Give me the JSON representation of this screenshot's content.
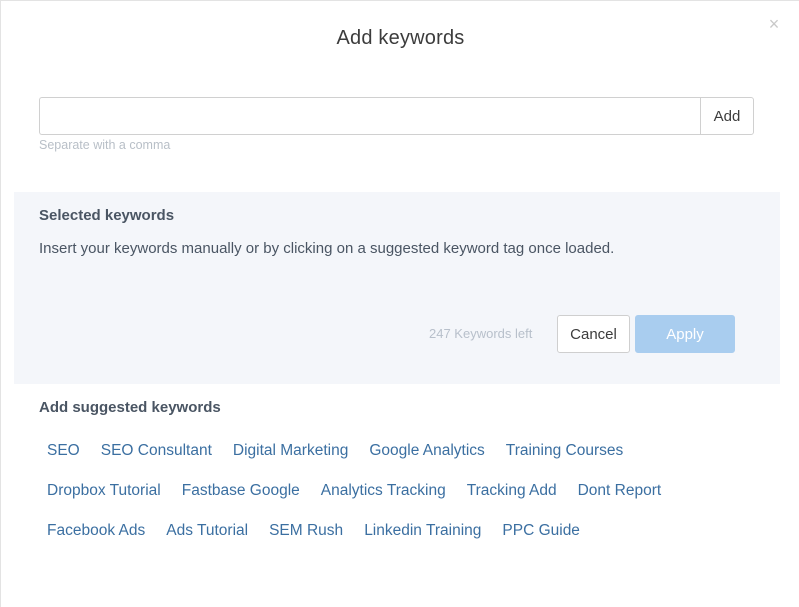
{
  "modal": {
    "title": "Add keywords",
    "close_label": "×"
  },
  "input": {
    "value": "",
    "placeholder": "",
    "add_label": "Add",
    "hint": "Separate with a comma"
  },
  "selected": {
    "title": "Selected keywords",
    "description": "Insert your keywords manually or by clicking on a suggested keyword tag once loaded.",
    "keywords_left": "247 Keywords left",
    "cancel_label": "Cancel",
    "apply_label": "Apply"
  },
  "suggested": {
    "title": "Add suggested keywords",
    "rows": [
      [
        "SEO",
        "SEO Consultant",
        "Digital Marketing",
        "Google Analytics",
        "Training Courses"
      ],
      [
        "Dropbox Tutorial",
        "Fastbase Google",
        "Analytics Tracking",
        "Tracking Add",
        "Dont Report"
      ],
      [
        "Facebook Ads",
        "Ads Tutorial",
        "SEM Rush",
        "Linkedin Training",
        "PPC Guide"
      ]
    ]
  },
  "colors": {
    "tag_text": "#3b6fa1",
    "apply_disabled": "#a9cdef",
    "panel_bg": "#f4f6fa"
  }
}
